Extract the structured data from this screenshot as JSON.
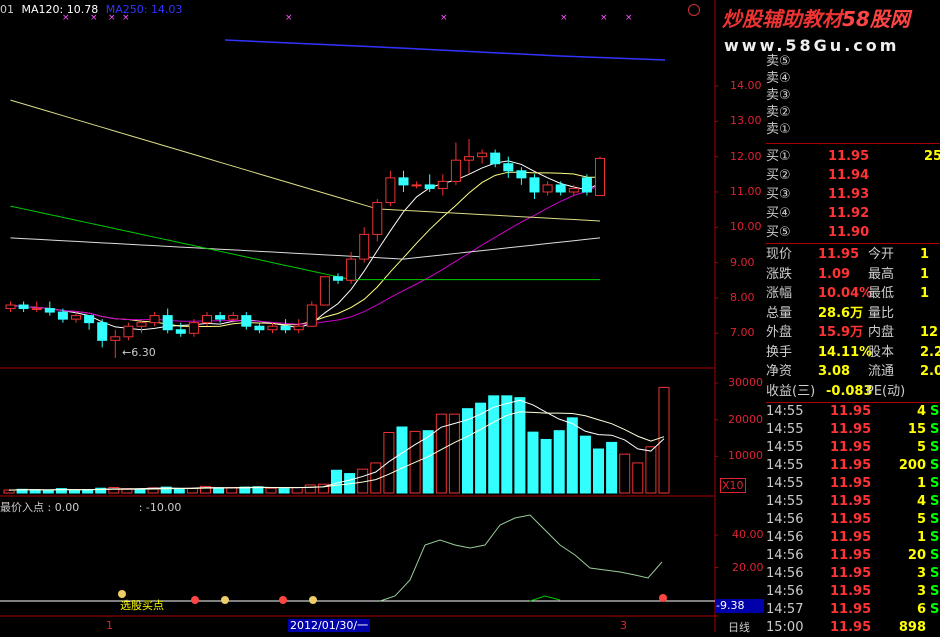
{
  "header": {
    "prefix": "01",
    "ma120_label": "MA120:",
    "ma120_value": "10.78",
    "ma250_label": "MA250:",
    "ma250_value": "14.03"
  },
  "watermark": {
    "title": "炒股辅助教材",
    "brand": "58股网",
    "url": "www.58Gu.com"
  },
  "price_axis": [
    "14.00",
    "13.00",
    "12.00",
    "11.00",
    "10.00",
    "9.00",
    "8.00",
    "7.00"
  ],
  "low_marker": "←6.30",
  "volume_axis": [
    "30000",
    "20000",
    "10000"
  ],
  "volume_unit": "X10",
  "indicator": {
    "title": "最价入点 : 0.00",
    "value": ": -10.00",
    "axis": [
      "40.00",
      "20.00"
    ],
    "current": "-9.38",
    "signal_label": "选股买点"
  },
  "time_axis": {
    "left_mark": "1",
    "date": "2012/01/30/一",
    "right_mark": "3",
    "period": "日线"
  },
  "order_book": {
    "sell": [
      {
        "label": "卖⑤"
      },
      {
        "label": "卖④"
      },
      {
        "label": "卖③"
      },
      {
        "label": "卖②"
      },
      {
        "label": "卖①"
      }
    ],
    "buy": [
      {
        "label": "买①",
        "price": "11.95",
        "vol": "25"
      },
      {
        "label": "买②",
        "price": "11.94",
        "vol": ""
      },
      {
        "label": "买③",
        "price": "11.93",
        "vol": ""
      },
      {
        "label": "买④",
        "price": "11.92",
        "vol": ""
      },
      {
        "label": "买⑤",
        "price": "11.90",
        "vol": ""
      }
    ]
  },
  "quote": [
    {
      "l1": "现价",
      "v1": "11.95",
      "c1": "red",
      "l2": "今开",
      "v2": "1"
    },
    {
      "l1": "涨跌",
      "v1": "1.09",
      "c1": "red",
      "l2": "最高",
      "v2": "1"
    },
    {
      "l1": "涨幅",
      "v1": "10.04%",
      "c1": "red",
      "l2": "最低",
      "v2": "1"
    },
    {
      "l1": "总量",
      "v1": "28.6万",
      "c1": "yel",
      "l2": "量比",
      "v2": ""
    },
    {
      "l1": "外盘",
      "v1": "15.9万",
      "c1": "red",
      "l2": "内盘",
      "v2": "12"
    },
    {
      "l1": "换手",
      "v1": "14.11%",
      "c1": "yel",
      "l2": "股本",
      "v2": "2.2"
    },
    {
      "l1": "净资",
      "v1": "3.08",
      "c1": "yel",
      "l2": "流通",
      "v2": "2.0"
    },
    {
      "l1": "收益(三)",
      "v1": "-0.083",
      "c1": "yel",
      "l2": "PE(动)",
      "v2": ""
    }
  ],
  "ticks": [
    {
      "t": "14:55",
      "p": "11.95",
      "v": "4",
      "s": "S"
    },
    {
      "t": "14:55",
      "p": "11.95",
      "v": "15",
      "s": "S"
    },
    {
      "t": "14:55",
      "p": "11.95",
      "v": "5",
      "s": "S"
    },
    {
      "t": "14:55",
      "p": "11.95",
      "v": "200",
      "s": "S"
    },
    {
      "t": "14:55",
      "p": "11.95",
      "v": "1",
      "s": "S"
    },
    {
      "t": "14:55",
      "p": "11.95",
      "v": "4",
      "s": "S"
    },
    {
      "t": "14:56",
      "p": "11.95",
      "v": "5",
      "s": "S"
    },
    {
      "t": "14:56",
      "p": "11.95",
      "v": "1",
      "s": "S"
    },
    {
      "t": "14:56",
      "p": "11.95",
      "v": "20",
      "s": "S"
    },
    {
      "t": "14:56",
      "p": "11.95",
      "v": "3",
      "s": "S"
    },
    {
      "t": "14:56",
      "p": "11.95",
      "v": "3",
      "s": "S"
    },
    {
      "t": "14:57",
      "p": "11.95",
      "v": "6",
      "s": "S"
    },
    {
      "t": "15:00",
      "p": "11.95",
      "v": "898",
      "s": ""
    }
  ],
  "colors": {
    "up": "#e33",
    "down": "#3ff",
    "ma_white": "#fff",
    "ma_yellow": "#ff0",
    "ma_magenta": "#c0c",
    "ma_green": "#0c0",
    "ma_blue": "#33f",
    "grid": "#a00"
  },
  "chart_data": {
    "type": "candlestick",
    "price_range": [
      6.0,
      15.0
    ],
    "candles": [
      [
        7.7,
        7.9,
        7.6,
        7.8
      ],
      [
        7.8,
        7.9,
        7.6,
        7.7
      ],
      [
        7.7,
        7.9,
        7.6,
        7.7
      ],
      [
        7.7,
        7.9,
        7.5,
        7.6
      ],
      [
        7.6,
        7.7,
        7.3,
        7.4
      ],
      [
        7.4,
        7.6,
        7.3,
        7.5
      ],
      [
        7.5,
        7.5,
        7.1,
        7.3
      ],
      [
        7.3,
        7.4,
        6.6,
        6.8
      ],
      [
        6.8,
        7.1,
        6.3,
        6.9
      ],
      [
        6.9,
        7.3,
        6.8,
        7.2
      ],
      [
        7.2,
        7.4,
        7.0,
        7.3
      ],
      [
        7.3,
        7.6,
        7.2,
        7.5
      ],
      [
        7.5,
        7.7,
        7.0,
        7.1
      ],
      [
        7.1,
        7.3,
        6.9,
        7.0
      ],
      [
        7.0,
        7.4,
        6.9,
        7.3
      ],
      [
        7.3,
        7.6,
        7.2,
        7.5
      ],
      [
        7.5,
        7.6,
        7.3,
        7.4
      ],
      [
        7.4,
        7.6,
        7.3,
        7.5
      ],
      [
        7.5,
        7.6,
        7.1,
        7.2
      ],
      [
        7.2,
        7.3,
        7.0,
        7.1
      ],
      [
        7.1,
        7.3,
        7.0,
        7.2
      ],
      [
        7.2,
        7.4,
        7.0,
        7.1
      ],
      [
        7.1,
        7.4,
        7.0,
        7.2
      ],
      [
        7.2,
        7.9,
        7.2,
        7.8
      ],
      [
        7.8,
        8.6,
        7.8,
        8.6
      ],
      [
        8.6,
        8.7,
        8.4,
        8.5
      ],
      [
        8.5,
        9.3,
        8.4,
        9.1
      ],
      [
        9.1,
        10.0,
        9.0,
        9.8
      ],
      [
        9.8,
        10.8,
        9.6,
        10.7
      ],
      [
        10.7,
        11.6,
        10.6,
        11.4
      ],
      [
        11.4,
        11.6,
        11.0,
        11.2
      ],
      [
        11.2,
        11.3,
        11.1,
        11.2
      ],
      [
        11.2,
        11.5,
        11.0,
        11.1
      ],
      [
        11.1,
        11.5,
        10.9,
        11.3
      ],
      [
        11.3,
        12.4,
        11.2,
        11.9
      ],
      [
        11.9,
        12.5,
        11.5,
        12.0
      ],
      [
        12.0,
        12.2,
        11.8,
        12.1
      ],
      [
        12.1,
        12.2,
        11.7,
        11.8
      ],
      [
        11.8,
        12.0,
        11.4,
        11.6
      ],
      [
        11.6,
        11.7,
        11.2,
        11.4
      ],
      [
        11.4,
        11.5,
        10.8,
        11.0
      ],
      [
        11.0,
        11.3,
        10.9,
        11.2
      ],
      [
        11.2,
        11.3,
        10.9,
        11.0
      ],
      [
        11.0,
        11.2,
        10.9,
        11.1
      ],
      [
        11.4,
        11.5,
        10.9,
        11.0
      ],
      [
        10.9,
        12.0,
        10.9,
        11.95
      ]
    ],
    "volumes": [
      800,
      1000,
      900,
      700,
      1200,
      800,
      900,
      1300,
      1500,
      1200,
      1100,
      1400,
      1600,
      1200,
      1300,
      1800,
      1400,
      1500,
      1600,
      1700,
      1300,
      1200,
      1500,
      2200,
      2400,
      6200,
      5300,
      6500,
      8200,
      16500,
      18000,
      16800,
      17000,
      21500,
      21500,
      23000,
      24500,
      26500,
      26500,
      26000,
      16600,
      14600,
      17000,
      20500,
      15500,
      12000,
      13800,
      10600,
      8200,
      12600,
      28800
    ]
  }
}
